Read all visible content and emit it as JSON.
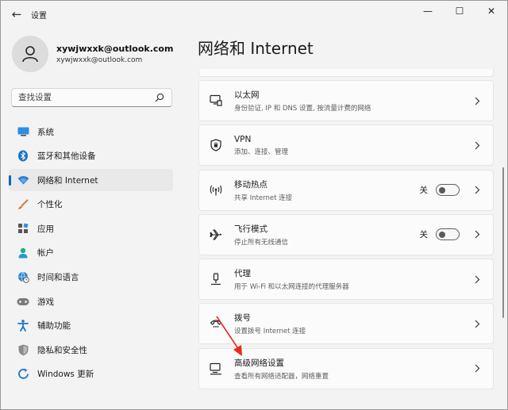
{
  "window": {
    "title": "设置",
    "back_glyph": "←",
    "min_glyph": "—",
    "max_glyph": "☐",
    "close_glyph": "✕"
  },
  "profile": {
    "name": "xywjwxxk@outlook.com",
    "email": "xywjwxxk@outlook.com"
  },
  "search": {
    "placeholder": "查找设置"
  },
  "nav": [
    {
      "label": "系统",
      "icon": "monitor-icon"
    },
    {
      "label": "蓝牙和其他设备",
      "icon": "bluetooth-icon"
    },
    {
      "label": "网络和 Internet",
      "icon": "wifi-icon",
      "active": true
    },
    {
      "label": "个性化",
      "icon": "brush-icon"
    },
    {
      "label": "应用",
      "icon": "apps-icon"
    },
    {
      "label": "帐户",
      "icon": "person-icon"
    },
    {
      "label": "时间和语言",
      "icon": "globe-clock-icon"
    },
    {
      "label": "游戏",
      "icon": "gamepad-icon"
    },
    {
      "label": "辅助功能",
      "icon": "accessibility-icon"
    },
    {
      "label": "隐私和安全性",
      "icon": "shield-icon"
    },
    {
      "label": "Windows 更新",
      "icon": "update-icon"
    }
  ],
  "main": {
    "title": "网络和 Internet",
    "items": [
      {
        "title": "以太网",
        "subtitle": "身份验证, IP 和 DNS 设置, 按流量计费的网络",
        "icon": "ethernet-icon"
      },
      {
        "title": "VPN",
        "subtitle": "添加、连接、管理",
        "icon": "vpn-shield-icon"
      },
      {
        "title": "移动热点",
        "subtitle": "共享 Internet 连接",
        "icon": "hotspot-icon",
        "toggle": "关"
      },
      {
        "title": "飞行模式",
        "subtitle": "停止所有无线通信",
        "icon": "airplane-icon",
        "toggle": "关"
      },
      {
        "title": "代理",
        "subtitle": "用于 Wi-Fi 和以太网连接的代理服务器",
        "icon": "proxy-icon"
      },
      {
        "title": "拨号",
        "subtitle": "设置拨号 Internet 连接",
        "icon": "dialup-icon"
      },
      {
        "title": "高级网络设置",
        "subtitle": "查看所有网络适配器，网络重置",
        "icon": "advanced-network-icon"
      }
    ]
  },
  "colors": {
    "accent": "#0067c0",
    "annotation_arrow": "#e8291c"
  }
}
